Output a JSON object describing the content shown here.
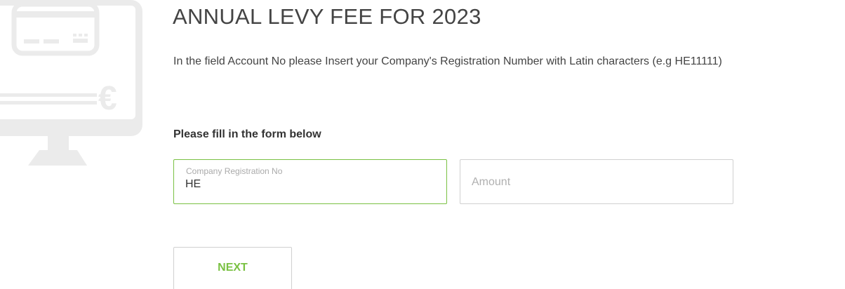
{
  "page": {
    "title": "ANNUAL LEVY FEE FOR 2023",
    "instructions": "In the field Account No please Insert your Company's Registration Number with Latin characters (e.g HE11111)"
  },
  "form": {
    "heading": "Please fill in the form below",
    "registration": {
      "label": "Company Registration No",
      "value": "HE"
    },
    "amount": {
      "placeholder": "Amount",
      "value": ""
    },
    "next_label": "NEXT"
  },
  "illustration": {
    "icon": "computer-payment-euro-icon",
    "symbol": "€"
  },
  "colors": {
    "accent": "#7ac143",
    "illustration": "#ebebeb",
    "border": "#d0d0d0"
  }
}
